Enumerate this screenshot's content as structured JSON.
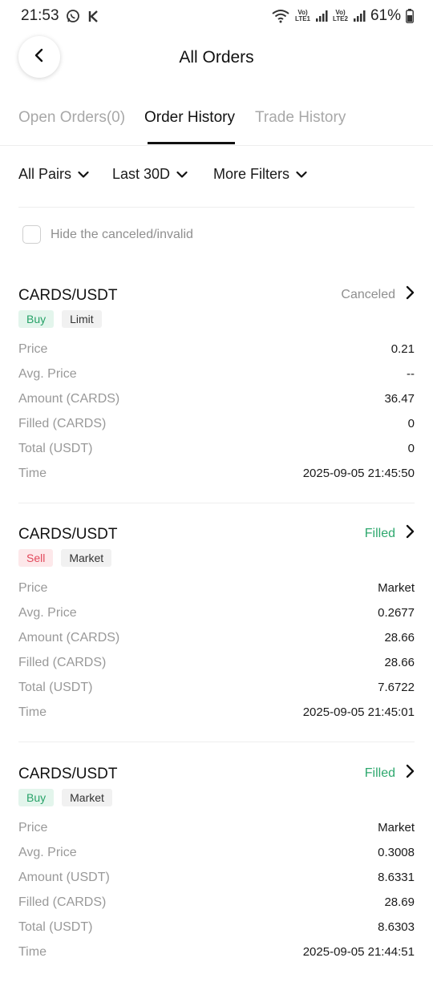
{
  "status_bar": {
    "time": "21:53",
    "sim1_label": "LTE1",
    "sim2_label": "LTE2",
    "volte_label": "Vo)",
    "battery": "61%"
  },
  "header": {
    "title": "All Orders"
  },
  "tabs": [
    {
      "label": "Open Orders(0)"
    },
    {
      "label": "Order History"
    },
    {
      "label": "Trade History"
    }
  ],
  "filters": [
    {
      "label": "All Pairs"
    },
    {
      "label": "Last 30D"
    },
    {
      "label": "More Filters"
    }
  ],
  "hide_toggle": {
    "label": "Hide the canceled/invalid"
  },
  "field_labels": {
    "price": "Price",
    "avg_price": "Avg. Price",
    "filled_cards": "Filled (CARDS)",
    "total_usdt": "Total (USDT)",
    "time": "Time"
  },
  "orders": [
    {
      "pair": "CARDS/USDT",
      "status": "Canceled",
      "side": "Buy",
      "type": "Limit",
      "price": "0.21",
      "avg_price": "--",
      "amount_label": "Amount (CARDS)",
      "amount": "36.47",
      "filled": "0",
      "total": "0",
      "time": "2025-09-05 21:45:50"
    },
    {
      "pair": "CARDS/USDT",
      "status": "Filled",
      "side": "Sell",
      "type": "Market",
      "price": "Market",
      "avg_price": "0.2677",
      "amount_label": "Amount (CARDS)",
      "amount": "28.66",
      "filled": "28.66",
      "total": "7.6722",
      "time": "2025-09-05 21:45:01"
    },
    {
      "pair": "CARDS/USDT",
      "status": "Filled",
      "side": "Buy",
      "type": "Market",
      "price": "Market",
      "avg_price": "0.3008",
      "amount_label": "Amount (USDT)",
      "amount": "8.6331",
      "filled": "28.69",
      "total": "8.6303",
      "time": "2025-09-05 21:44:51"
    }
  ],
  "colors": {
    "filled": "#2ea86e",
    "canceled": "#8f8f8f",
    "buy_tag_bg": "#e3f5ec",
    "sell_tag_bg": "#fde8ea"
  }
}
